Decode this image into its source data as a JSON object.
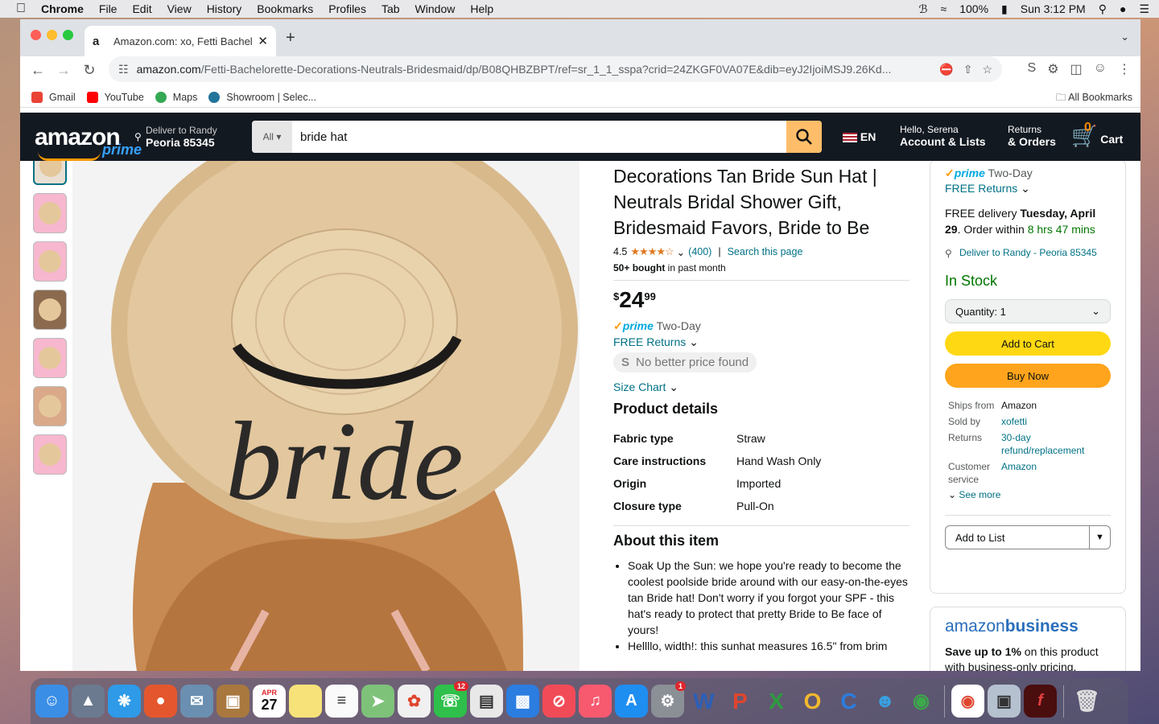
{
  "menubar": {
    "app": "Chrome",
    "items": [
      "File",
      "Edit",
      "View",
      "History",
      "Bookmarks",
      "Profiles",
      "Tab",
      "Window",
      "Help"
    ],
    "battery": "100%",
    "clock": "Sun 3:12 PM"
  },
  "browser": {
    "tab_title": "Amazon.com: xo, Fetti Bachelo",
    "url_domain": "amazon.com",
    "url_path": "/Fetti-Bachelorette-Decorations-Neutrals-Bridesmaid/dp/B08QHBZBPT/ref=sr_1_1_sspa?crid=24ZKGF0VA07E&dib=eyJ2IjoiMSJ9.26Kd...",
    "bookmarks": [
      "Gmail",
      "YouTube",
      "Maps",
      "Showroom | Selec..."
    ],
    "all_bookmarks": "All Bookmarks"
  },
  "amazon_header": {
    "logo": "amazon",
    "logo_prime": "prime",
    "deliver_line1": "Deliver to Randy",
    "deliver_line2": "Peoria 85345",
    "search_category": "All",
    "search_value": "bride hat",
    "lang": "EN",
    "account_line1": "Hello, Serena",
    "account_line2": "Account & Lists",
    "orders_line1": "Returns",
    "orders_line2": "& Orders",
    "cart_count": "0",
    "cart_label": "Cart"
  },
  "product": {
    "title": "Decorations Tan Bride Sun Hat | Neutrals Bridal Shower Gift, Bridesmaid Favors, Bride to Be",
    "rating": "4.5",
    "rating_count": "(400)",
    "search_page": "Search this page",
    "bought_bold": "50+ bought",
    "bought_rest": " in past month",
    "price_symbol": "$",
    "price_whole": "24",
    "price_fraction": "99",
    "prime_label": "prime",
    "prime_speed": "Two-Day",
    "free_returns": "FREE Returns",
    "no_better_price": "No better price found",
    "size_chart": "Size Chart",
    "image_text": "bride"
  },
  "details": {
    "heading": "Product details",
    "rows": [
      {
        "k": "Fabric type",
        "v": "Straw"
      },
      {
        "k": "Care instructions",
        "v": "Hand Wash Only"
      },
      {
        "k": "Origin",
        "v": "Imported"
      },
      {
        "k": "Closure type",
        "v": "Pull-On"
      }
    ]
  },
  "about": {
    "heading": "About this item",
    "bullets": [
      "Soak Up the Sun: we hope you're ready to become the coolest poolside bride around with our easy-on-the-eyes tan Bride hat! Don't worry if you forgot your SPF - this hat's ready to protect that pretty Bride to Be face of yours!",
      "Hellllo, width!: this sunhat measures 16.5\" from brim"
    ]
  },
  "buybox": {
    "prime_speed": "Two-Day",
    "free_returns": "FREE Returns",
    "delivery_prefix": "FREE delivery ",
    "delivery_date": "Tuesday, April 29",
    "order_within": "Order within ",
    "countdown": "8 hrs 47 mins",
    "deliver_to": "Deliver to Randy - Peoria 85345",
    "stock": "In Stock",
    "quantity": "Quantity:  1",
    "add_to_cart": "Add to Cart",
    "buy_now": "Buy Now",
    "ships": [
      {
        "k": "Ships from",
        "v": "Amazon",
        "link": false
      },
      {
        "k": "Sold by",
        "v": "xofetti",
        "link": true
      },
      {
        "k": "Returns",
        "v": "30-day refund/replacement",
        "link": true
      },
      {
        "k": "Customer service",
        "v": "Amazon",
        "link": true
      }
    ],
    "see_more": "See more",
    "add_to_list": "Add to List"
  },
  "business": {
    "logo_a": "amazon",
    "logo_b": "business",
    "text_prefix": "Save up to 1%",
    "text_rest": " on this product with business-only pricing."
  },
  "dock": {
    "calendar_month": "APR",
    "calendar_day": "27",
    "facetime_badge": "12",
    "settings_badge": "1"
  },
  "colors": {
    "amazon_header": "#131921",
    "add_to_cart": "#ffd814",
    "buy_now": "#ffa41c",
    "link": "#007185",
    "in_stock": "#007600"
  }
}
